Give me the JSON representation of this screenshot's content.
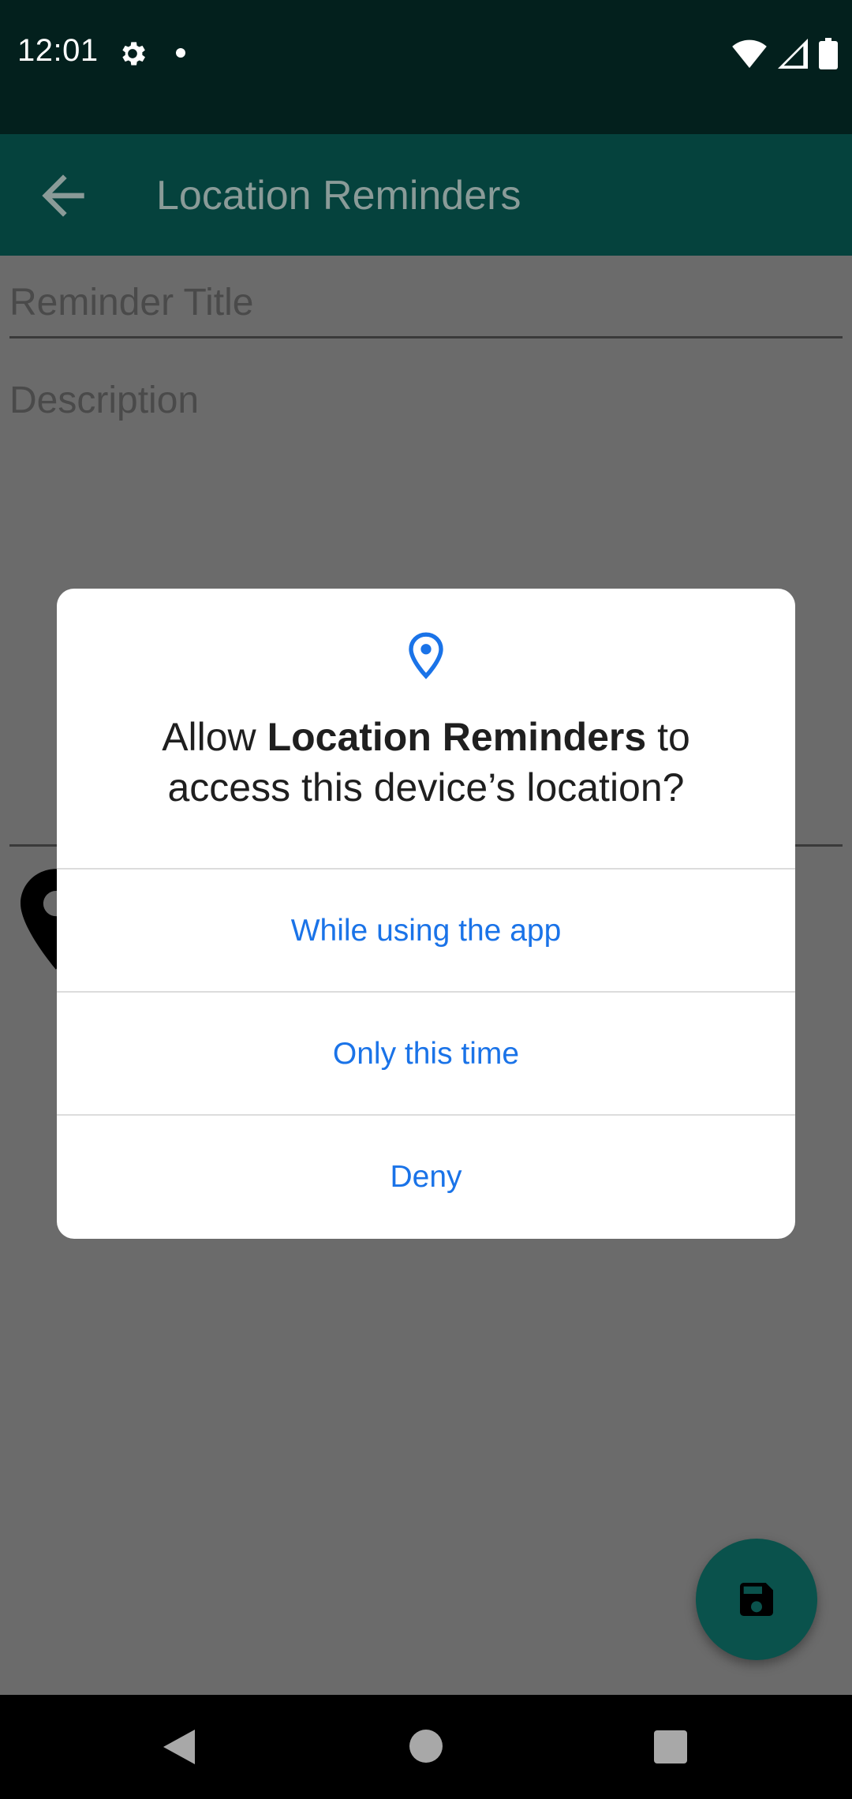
{
  "status_bar": {
    "time": "12:01",
    "icons": [
      "gear-icon",
      "dot-icon",
      "wifi-icon",
      "signal-icon",
      "battery-icon"
    ]
  },
  "app_bar": {
    "title": "Location Reminders",
    "back_icon": "arrow-back-icon"
  },
  "form": {
    "title_placeholder": "Reminder Title",
    "description_placeholder": "Description",
    "location_icon": "map-pin-icon"
  },
  "fab": {
    "icon": "save-icon"
  },
  "dialog": {
    "icon": "location-pin-icon",
    "title_prefix": "Allow ",
    "title_app": "Location Reminders",
    "title_suffix_line1": " to",
    "title_line2": "access this device’s location?",
    "options": [
      {
        "label": "While using the app"
      },
      {
        "label": "Only this time"
      },
      {
        "label": "Deny"
      }
    ]
  },
  "nav_bar": {
    "icons": [
      "nav-back-icon",
      "nav-home-icon",
      "nav-recents-icon"
    ]
  },
  "colors": {
    "status_bar_bg": "#03201d",
    "app_bar_bg": "#05423d",
    "accent_blue": "#1a73e8",
    "fab_bg": "#0a524c",
    "scrim": "#6b6b6b"
  }
}
